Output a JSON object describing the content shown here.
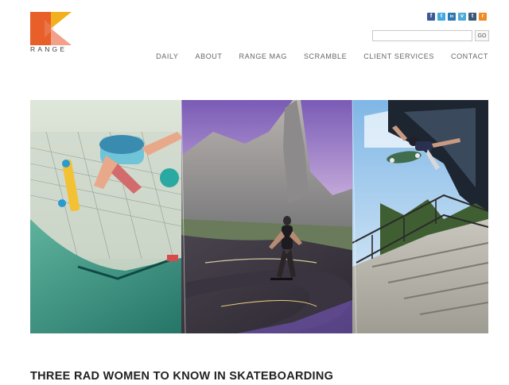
{
  "brand": {
    "name": "RANGE",
    "colors": {
      "orange": "#e85f2a",
      "gold": "#f2b01e",
      "peach": "#f2a08a"
    }
  },
  "social": [
    {
      "name": "facebook-icon",
      "glyph": "f",
      "color": "#3b5998"
    },
    {
      "name": "twitter-icon",
      "glyph": "t",
      "color": "#3fa9e0"
    },
    {
      "name": "linkedin-icon",
      "glyph": "in",
      "color": "#2d77b3"
    },
    {
      "name": "vimeo-icon",
      "glyph": "v",
      "color": "#4ea9d8"
    },
    {
      "name": "tumblr-icon",
      "glyph": "t",
      "color": "#3a5876"
    },
    {
      "name": "rss-icon",
      "glyph": "r",
      "color": "#f08a23"
    }
  ],
  "search": {
    "value": "",
    "placeholder": "",
    "button_label": "GO"
  },
  "nav": {
    "items": [
      {
        "label": "DAILY"
      },
      {
        "label": "ABOUT"
      },
      {
        "label": "RANGE MAG"
      },
      {
        "label": "SCRAMBLE"
      },
      {
        "label": "CLIENT SERVICES"
      },
      {
        "label": "CONTACT"
      }
    ]
  },
  "hero": {
    "image": "skateboarding-collage"
  },
  "article": {
    "title": "THREE RAD WOMEN TO KNOW IN SKATEBOARDING"
  }
}
